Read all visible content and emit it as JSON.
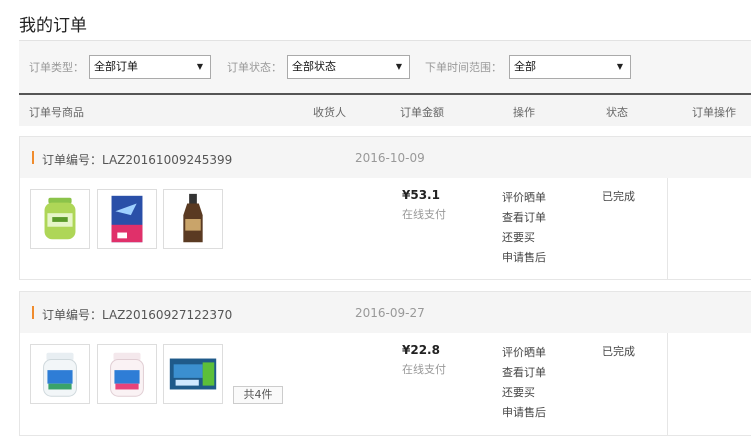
{
  "page": {
    "title": "我的订单"
  },
  "filters": {
    "type": {
      "label": "订单类型：",
      "value": "全部订单"
    },
    "status": {
      "label": "订单状态：",
      "value": "全部状态"
    },
    "time": {
      "label": "下单时间范围：",
      "value": "全部"
    }
  },
  "columns": [
    "订单号商品",
    "收货人",
    "订单金额",
    "操作",
    "状态",
    "订单操作"
  ],
  "orders": [
    {
      "number": "订单编号：LAZ20161009245399",
      "date": "2016-10-09",
      "products": [
        "green-gum-bottle",
        "blue-gum-box",
        "brown-sauce-bottle"
      ],
      "price": "¥53.1",
      "payment": "在线支付",
      "actions": [
        "评价晒单",
        "查看订单",
        "还要买",
        "申请售后"
      ],
      "status": "已完成",
      "count": ""
    },
    {
      "number": "订单编号：LAZ20160927122370",
      "date": "2016-09-27",
      "products": [
        "mint-gum-bottle",
        "pink-gum-bottle",
        "gum-pack"
      ],
      "price": "¥22.8",
      "payment": "在线支付",
      "actions": [
        "评价晒单",
        "查看订单",
        "还要买",
        "申请售后"
      ],
      "status": "已完成",
      "count": "共4件"
    }
  ],
  "colors": {
    "accent": "#f08c2e",
    "header_border": "#555555"
  }
}
